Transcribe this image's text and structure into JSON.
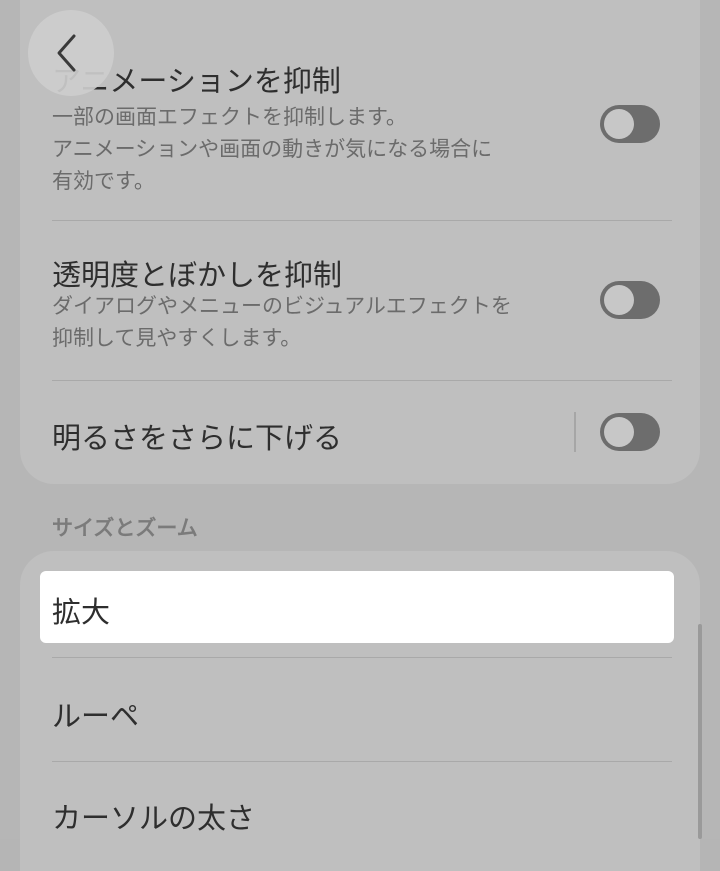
{
  "settings_top": {
    "items": [
      {
        "title": "アニメーションを抑制",
        "desc": [
          "一部の画面エフェクトを抑制します。",
          "アニメーションや画面の動きが気になる場合に",
          "有効です。"
        ],
        "toggle_on": false
      },
      {
        "title": "透明度とぼかしを抑制",
        "desc": [
          "ダイアログやメニューのビジュアルエフェクトを",
          "抑制して見やすくします。"
        ],
        "toggle_on": false
      },
      {
        "title": "明るさをさらに下げる",
        "toggle_on": false
      }
    ]
  },
  "section": {
    "header": "サイズとズーム",
    "items": [
      {
        "label": "拡大"
      },
      {
        "label": "ルーペ"
      },
      {
        "label": "カーソルの太さ"
      }
    ]
  },
  "icons": {
    "back": "chevron-left-icon"
  },
  "colors": {
    "dim_overlay": "#b6b6b6",
    "highlight": "#ffffff",
    "toggle_off": "#6d6d6d"
  }
}
